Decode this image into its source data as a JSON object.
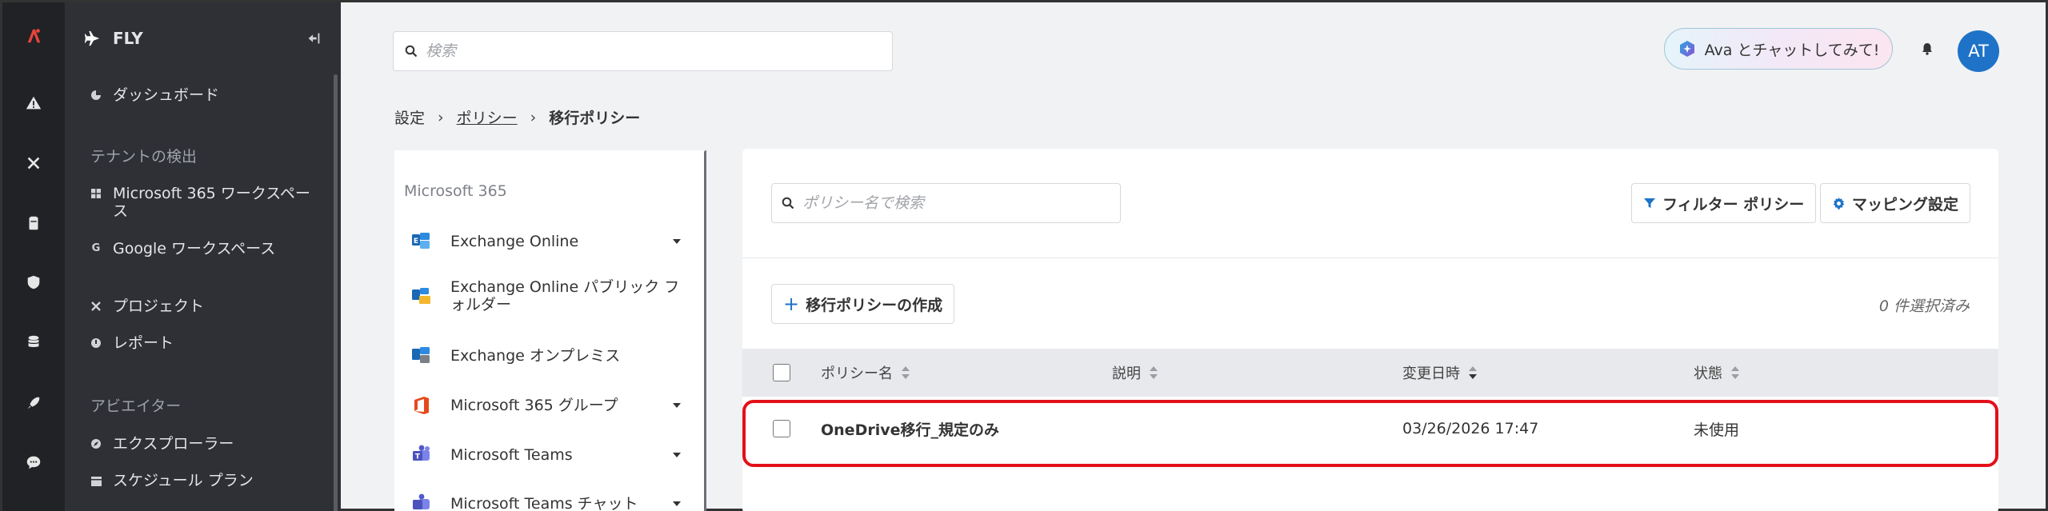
{
  "app": {
    "name": "FLY"
  },
  "rail": [
    {
      "name": "logo-icon"
    },
    {
      "name": "alert-icon"
    },
    {
      "name": "tools-icon"
    },
    {
      "name": "clipboard-icon"
    },
    {
      "name": "shield-icon"
    },
    {
      "name": "database-icon"
    },
    {
      "name": "rocket-icon"
    },
    {
      "name": "chat-icon"
    }
  ],
  "nav": {
    "dashboard": "ダッシュボード",
    "section_tenant": "テナントの検出",
    "m365_workspace": "Microsoft 365 ワークスペース",
    "google_workspace": "Google ワークスペース",
    "project": "プロジェクト",
    "report": "レポート",
    "section_navigator": "アビエイター",
    "explorer": "エクスプローラー",
    "schedule_plan": "スケジュール プラン"
  },
  "header": {
    "search_placeholder": "検索",
    "ava_label": "Ava とチャットしてみて!",
    "avatar_initials": "AT"
  },
  "breadcrumb": {
    "settings": "設定",
    "policy": "ポリシー",
    "current": "移行ポリシー"
  },
  "policy_list": {
    "heading": "Microsoft 365",
    "items": [
      {
        "label": "Exchange Online",
        "icon": "exchange-icon",
        "expandable": true
      },
      {
        "label": "Exchange Online パブリック フォルダー",
        "icon": "public-folder-icon",
        "expandable": false
      },
      {
        "label": "Exchange オンプレミス",
        "icon": "exchange-onprem-icon",
        "expandable": false
      },
      {
        "label": "Microsoft 365 グループ",
        "icon": "office-icon",
        "expandable": true
      },
      {
        "label": "Microsoft Teams",
        "icon": "teams-icon",
        "expandable": true
      },
      {
        "label": "Microsoft Teams チャット",
        "icon": "teams-chat-icon",
        "expandable": true
      }
    ]
  },
  "main": {
    "search_placeholder": "ポリシー名で検索",
    "filter_label": "フィルター ポリシー",
    "mapping_label": "マッピング設定",
    "create_label": "移行ポリシーの作成",
    "selected_count": "0 件選択済み",
    "columns": {
      "name": "ポリシー名",
      "description": "説明",
      "modified": "変更日時",
      "status": "状態"
    },
    "rows": [
      {
        "name": "OneDrive移行_規定のみ",
        "description": "",
        "modified": "03/26/2026 17:47",
        "status": "未使用"
      }
    ]
  },
  "colors": {
    "accent": "#1e73c8",
    "highlight": "#e3101a",
    "logo": "#e8453c"
  }
}
